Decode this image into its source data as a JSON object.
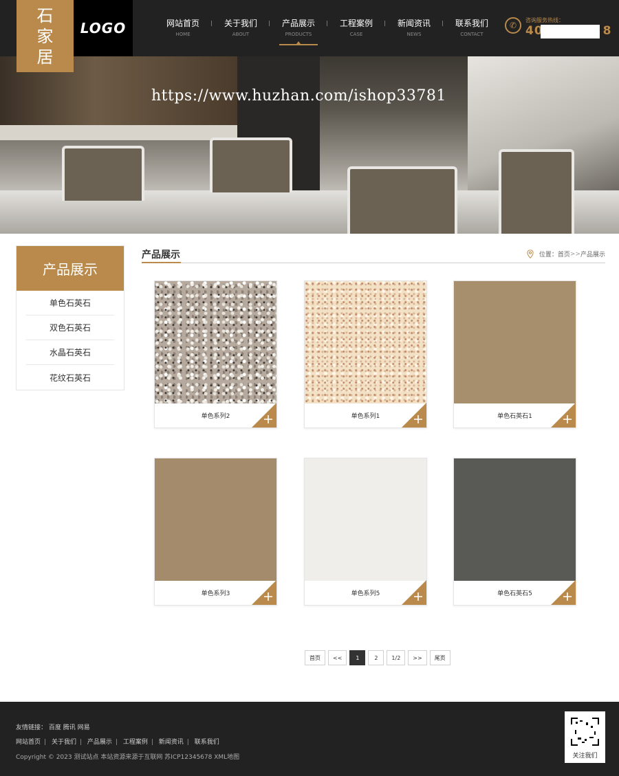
{
  "header": {
    "brand_chars": [
      "石",
      "家",
      "居"
    ],
    "logo": "LOGO",
    "nav": [
      {
        "cn": "网站首页",
        "en": "HOME"
      },
      {
        "cn": "关于我们",
        "en": "ABOUT"
      },
      {
        "cn": "产品展示",
        "en": "PRODUCTS"
      },
      {
        "cn": "工程案例",
        "en": "CASE"
      },
      {
        "cn": "新闻资讯",
        "en": "NEWS"
      },
      {
        "cn": "联系我们",
        "en": "CONTACT"
      }
    ],
    "active_nav": "产品展示",
    "hotline_label": "咨询服务热线：",
    "hotline_prefix": "40",
    "hotline_suffix": "8"
  },
  "banner": {
    "watermark": "https://www.huzhan.com/ishop33781"
  },
  "sidebar": {
    "title": "产品展示",
    "items": [
      "单色石英石",
      "双色石英石",
      "水晶石英石",
      "花纹石英石"
    ]
  },
  "section": {
    "title": "产品展示",
    "breadcrumb_prefix": "位置：",
    "breadcrumb_home": "首页",
    "breadcrumb_sep": ">>",
    "breadcrumb_current": "产品展示"
  },
  "products": [
    {
      "name": "单色系列2"
    },
    {
      "name": "单色系列1"
    },
    {
      "name": "单色石英石1"
    },
    {
      "name": "单色系列3"
    },
    {
      "name": "单色系列5"
    },
    {
      "name": "单色石英石5"
    }
  ],
  "pagination": {
    "first": "首页",
    "prev": "<<",
    "pages": [
      "1",
      "2"
    ],
    "current": "1",
    "info": "1/2",
    "next": ">>",
    "last": "尾页"
  },
  "footer": {
    "friend_links_label": "友情链接：",
    "friend_links": [
      "百度",
      "腾讯",
      "网易"
    ],
    "nav": [
      "网站首页",
      "关于我们",
      "产品展示",
      "工程案例",
      "新闻资讯",
      "联系我们"
    ],
    "copyright": "Copyright © 2023 测试站点 本站资源来源于互联网 苏ICP12345678 XML地图",
    "qr_label": "关注我们"
  },
  "colors": {
    "accent": "#b98a4c",
    "header_bg": "#222222",
    "footer_bg": "#222222"
  }
}
